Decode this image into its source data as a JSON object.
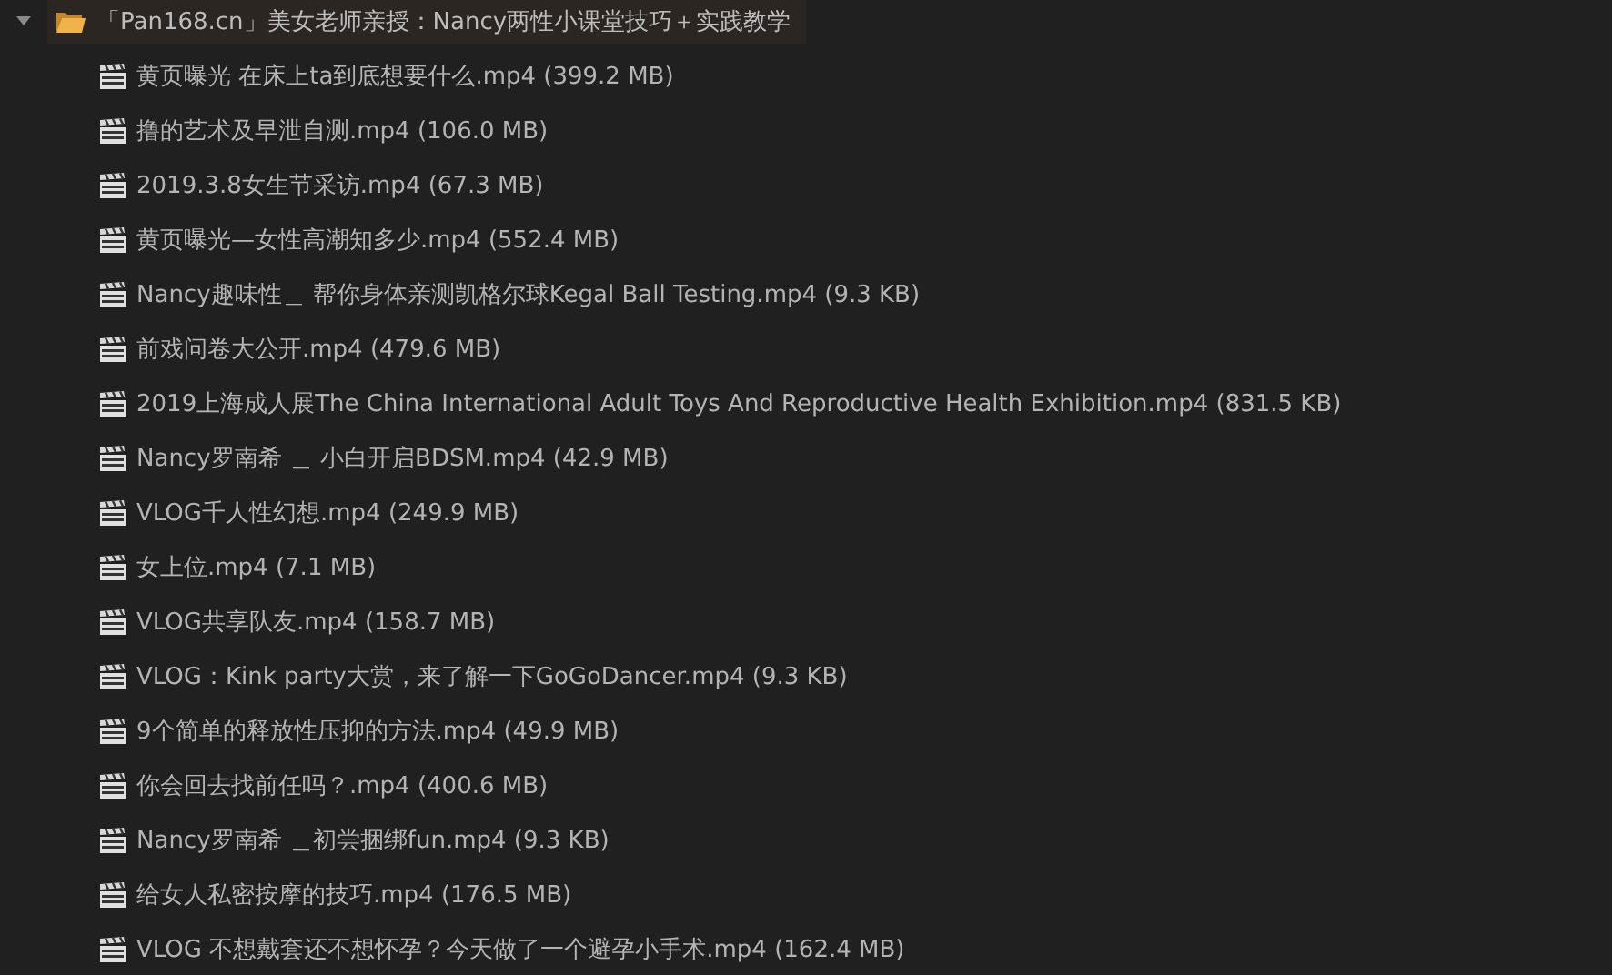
{
  "folder": {
    "name": "「Pan168.cn」美女老师亲授：Nancy两性小课堂技巧＋实践教学",
    "expanded": true,
    "selected": true
  },
  "files": [
    {
      "name": "黄页曝光 在床上ta到底想要什么.mp4",
      "size": "(399.2 MB)"
    },
    {
      "name": "撸的艺术及早泄自测.mp4",
      "size": "(106.0 MB)"
    },
    {
      "name": "2019.3.8女生节采访.mp4",
      "size": "(67.3 MB)"
    },
    {
      "name": "黄页曝光—女性高潮知多少.mp4",
      "size": "(552.4 MB)"
    },
    {
      "name": "Nancy趣味性＿ 帮你身体亲测凯格尔球Kegal Ball Testing.mp4",
      "size": "(9.3 KB)"
    },
    {
      "name": "前戏问卷大公开.mp4",
      "size": "(479.6 MB)"
    },
    {
      "name": "2019上海成人展The China International Adult Toys And Reproductive Health Exhibition.mp4",
      "size": "(831.5 KB)"
    },
    {
      "name": "Nancy罗南希 ＿ 小白开启BDSM.mp4",
      "size": "(42.9 MB)"
    },
    {
      "name": "VLOG千人性幻想.mp4",
      "size": "(249.9 MB)"
    },
    {
      "name": "女上位.mp4",
      "size": "(7.1 MB)"
    },
    {
      "name": "VLOG共享队友.mp4",
      "size": "(158.7 MB)"
    },
    {
      "name": "VLOG：Kink party大赏，来了解一下GoGoDancer.mp4",
      "size": "(9.3 KB)"
    },
    {
      "name": "9个简单的释放性压抑的方法.mp4",
      "size": "(49.9 MB)"
    },
    {
      "name": "你会回去找前任吗？.mp4",
      "size": "(400.6 MB)"
    },
    {
      "name": "Nancy罗南希 ＿初尝捆绑fun.mp4",
      "size": "(9.3 KB)"
    },
    {
      "name": "给女人私密按摩的技巧.mp4",
      "size": "(176.5 MB)"
    },
    {
      "name": "VLOG 不想戴套还不想怀孕？今天做了一个避孕小手术.mp4",
      "size": "(162.4 MB)"
    }
  ]
}
